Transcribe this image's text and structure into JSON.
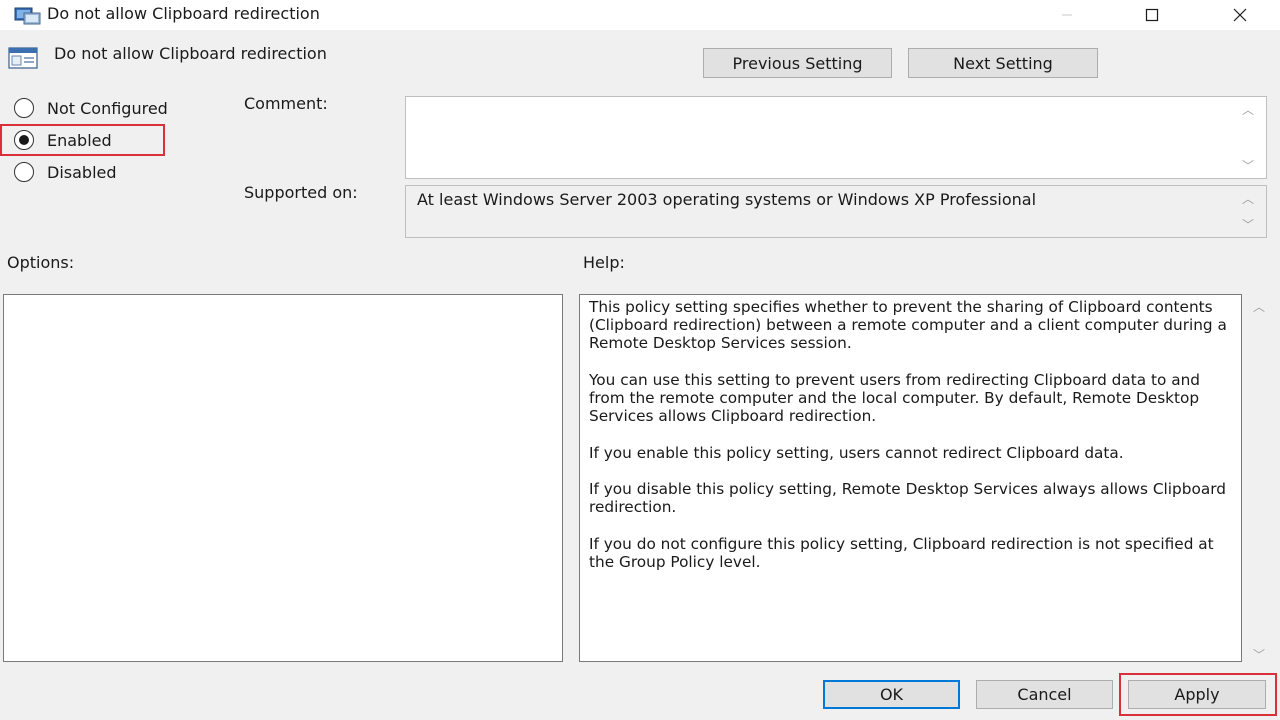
{
  "window": {
    "title": "Do not allow Clipboard redirection",
    "icon": "policy-icon"
  },
  "header": {
    "title": "Do not allow Clipboard redirection",
    "icon": "policy-setting-icon",
    "prev_label": "Previous Setting",
    "next_label": "Next Setting"
  },
  "state": {
    "options": [
      {
        "label": "Not Configured",
        "selected": false
      },
      {
        "label": "Enabled",
        "selected": true
      },
      {
        "label": "Disabled",
        "selected": false
      }
    ]
  },
  "comment": {
    "label": "Comment:",
    "value": ""
  },
  "supported": {
    "label": "Supported on:",
    "value": "At least Windows Server 2003 operating systems or Windows XP Professional"
  },
  "options_panel": {
    "label": "Options:"
  },
  "help": {
    "label": "Help:",
    "paragraphs": [
      "This policy setting specifies whether to prevent the sharing of Clipboard contents (Clipboard redirection) between a remote computer and a client computer during a Remote Desktop Services session.",
      "You can use this setting to prevent users from redirecting Clipboard data to and from the remote computer and the local computer. By default, Remote Desktop Services allows Clipboard redirection.",
      "If you enable this policy setting, users cannot redirect Clipboard data.",
      "If you disable this policy setting, Remote Desktop Services always allows Clipboard redirection.",
      "If you do not configure this policy setting, Clipboard redirection is not specified at the Group Policy level."
    ]
  },
  "footer": {
    "ok_label": "OK",
    "cancel_label": "Cancel",
    "apply_label": "Apply"
  },
  "colors": {
    "highlight": "#d9303a",
    "focus": "#0078d7"
  }
}
